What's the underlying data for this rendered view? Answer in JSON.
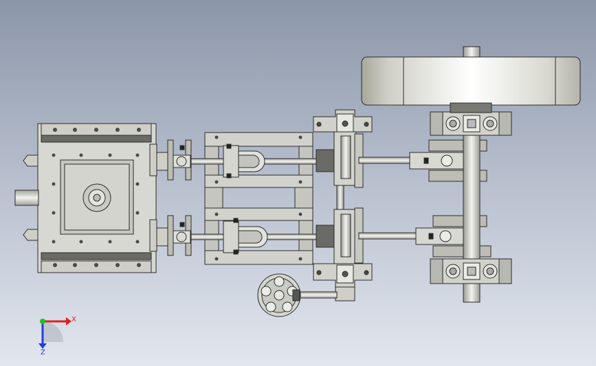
{
  "viewport": {
    "background_top": "#8b96a8",
    "background_bottom": "#e2e6ee"
  },
  "triad": {
    "x_label": "X",
    "z_label": "Z",
    "x_color": "#e02020",
    "y_color": "#20c020",
    "z_color": "#2040e0"
  },
  "model": {
    "part_fill": "#d6d6d0",
    "part_stroke": "#2a2a2a",
    "shadow_fill": "#9a9a94",
    "hole_fill": "#3a3a3a"
  }
}
